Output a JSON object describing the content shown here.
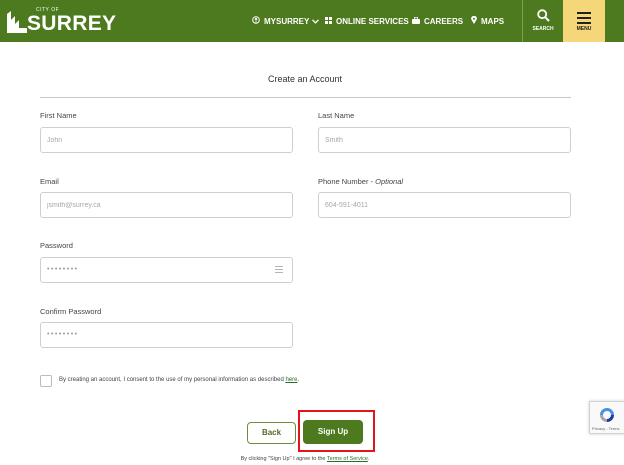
{
  "header": {
    "logo_small": "CITY OF",
    "logo_main": "SURREY",
    "nav": {
      "mysurrey": "MYSURREY",
      "online_services": "ONLINE SERVICES",
      "careers": "CAREERS",
      "maps": "MAPS"
    },
    "search_label": "SEARCH",
    "menu_label": "MENU"
  },
  "form": {
    "title": "Create an Account",
    "first_name": {
      "label": "First Name",
      "placeholder": "John",
      "value": ""
    },
    "last_name": {
      "label": "Last Name",
      "placeholder": "Smith",
      "value": ""
    },
    "email": {
      "label": "Email",
      "placeholder": "jsmith@surrey.ca",
      "value": ""
    },
    "phone": {
      "label": "Phone Number",
      "optional": " - Optional",
      "placeholder": "604-591-4011",
      "value": ""
    },
    "password": {
      "label": "Password",
      "masked": "••••••••"
    },
    "confirm_password": {
      "label": "Confirm Password",
      "masked": "••••••••"
    },
    "consent": {
      "checked": false,
      "text": "By creating an account, I consent to the use of my personal information as described ",
      "link": "here",
      "suffix": "."
    },
    "back_label": "Back",
    "signup_label": "Sign Up",
    "terms": {
      "text": "By clicking \"Sign Up\" I agree to the ",
      "link": "Terms of Service",
      "suffix": "."
    }
  },
  "recaptcha": {
    "text": "Privacy - Terms"
  },
  "colors": {
    "brand_green": "#4d7a1f",
    "menu_yellow": "#f5d77a",
    "highlight_red": "#e0161a"
  }
}
